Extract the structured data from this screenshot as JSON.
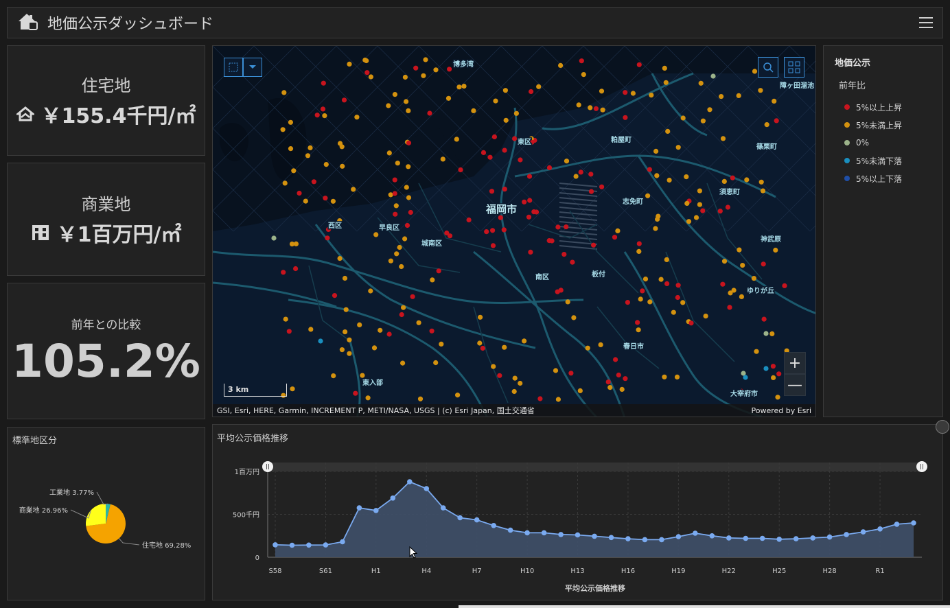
{
  "header": {
    "title": "地価公示ダッシュボード",
    "home_icon": "house-icon",
    "menu_icon": "hamburger-menu-icon"
  },
  "indicators": {
    "residential": {
      "label": "住宅地",
      "value": "￥155.4千円/㎡",
      "icon": "house-outline-icon"
    },
    "commercial": {
      "label": "商業地",
      "value": "￥1百万円/㎡",
      "icon": "building-icon"
    },
    "comparison": {
      "label": "前年との比較",
      "value": "105.2%"
    }
  },
  "map": {
    "place_labels": [
      {
        "text": "博多湾",
        "x": 350,
        "y": 30
      },
      {
        "text": "東区",
        "x": 444,
        "y": 143
      },
      {
        "text": "粕屋町",
        "x": 580,
        "y": 140
      },
      {
        "text": "篠栗町",
        "x": 792,
        "y": 150
      },
      {
        "text": "福岡市",
        "x": 398,
        "y": 243
      },
      {
        "text": "志免町",
        "x": 597,
        "y": 230
      },
      {
        "text": "須恵町",
        "x": 738,
        "y": 216
      },
      {
        "text": "西区",
        "x": 168,
        "y": 265
      },
      {
        "text": "早良区",
        "x": 242,
        "y": 268
      },
      {
        "text": "城南区",
        "x": 304,
        "y": 291
      },
      {
        "text": "神武原",
        "x": 798,
        "y": 285
      },
      {
        "text": "南区",
        "x": 470,
        "y": 340
      },
      {
        "text": "板付",
        "x": 552,
        "y": 336
      },
      {
        "text": "ゆりが丘",
        "x": 778,
        "y": 360
      },
      {
        "text": "春日市",
        "x": 598,
        "y": 441
      },
      {
        "text": "東入部",
        "x": 218,
        "y": 494
      },
      {
        "text": "大宰府市",
        "x": 754,
        "y": 510
      },
      {
        "text": "障ヶ田溜池",
        "x": 826,
        "y": 61
      }
    ],
    "scale_label": "3 km",
    "attribution": "GSI, Esri, HERE, Garmin, INCREMENT P, METI/NASA, USGS | (c) Esri Japan, 国土交通省",
    "powered_by": "Powered by Esri",
    "zoom_in": "+",
    "zoom_out": "—"
  },
  "legend": {
    "title": "地価公示",
    "subtitle": "前年比",
    "items": [
      {
        "label": "5%以上上昇",
        "color": "#c8141e"
      },
      {
        "label": "5%未満上昇",
        "color": "#d4920f"
      },
      {
        "label": "0%",
        "color": "#9cb38a"
      },
      {
        "label": "5%未満下落",
        "color": "#1a8fbf"
      },
      {
        "label": "5%以上下落",
        "color": "#1f4fa8"
      }
    ]
  },
  "pie": {
    "title": "標準地区分",
    "chart_data": {
      "type": "pie",
      "labels": [
        "住宅地",
        "商業地",
        "工業地"
      ],
      "values": [
        69.28,
        26.96,
        3.77
      ],
      "display": [
        "住宅地 69.28%",
        "商業地 26.96%",
        "工業地 3.77%"
      ],
      "colors": [
        "#f5a300",
        "#ffff1a",
        "#2ab5a5"
      ]
    }
  },
  "line": {
    "title": "平均公示価格推移",
    "chart_data": {
      "type": "area",
      "xlabel": "平均公示価格推移",
      "ylabel": "",
      "x": [
        "S58",
        "S59",
        "S60",
        "S61",
        "S62",
        "S63",
        "H1",
        "H2",
        "H3",
        "H4",
        "H5",
        "H6",
        "H7",
        "H8",
        "H9",
        "H10",
        "H11",
        "H12",
        "H13",
        "H14",
        "H15",
        "H16",
        "H17",
        "H18",
        "H19",
        "H20",
        "H21",
        "H22",
        "H23",
        "H24",
        "H25",
        "H26",
        "H27",
        "H28",
        "H29",
        "H30",
        "R1",
        "R2",
        "R3"
      ],
      "xticks": [
        "S58",
        "S61",
        "H1",
        "H4",
        "H7",
        "H10",
        "H13",
        "H16",
        "H19",
        "H22",
        "H25",
        "H28",
        "R1"
      ],
      "yticks": [
        0,
        500,
        1000
      ],
      "ytick_labels": [
        "0",
        "500千円",
        "1百万円"
      ],
      "ylim": [
        0,
        1000
      ],
      "unit": "千円",
      "values": [
        145,
        140,
        142,
        143,
        180,
        575,
        545,
        690,
        880,
        800,
        575,
        460,
        435,
        370,
        315,
        285,
        285,
        265,
        260,
        245,
        230,
        215,
        205,
        205,
        240,
        280,
        250,
        225,
        220,
        220,
        210,
        215,
        225,
        235,
        265,
        295,
        330,
        385,
        400
      ],
      "color": "#7aaaf0"
    }
  }
}
